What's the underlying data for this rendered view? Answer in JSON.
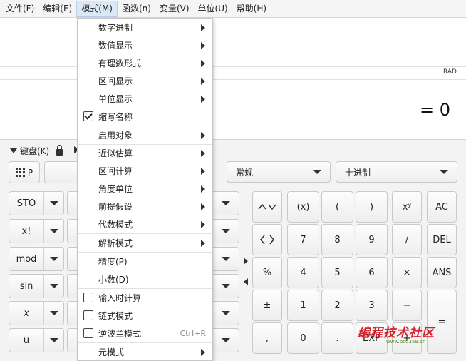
{
  "menubar": {
    "items": [
      "文件(F)",
      "编辑(E)",
      "模式(M)",
      "函数(n)",
      "变量(V)",
      "单位(U)",
      "帮助(H)"
    ],
    "active_index": 2
  },
  "display": {
    "angle_mode": "RAD",
    "result": "= 0"
  },
  "keyboard": {
    "label": "键盘(K)"
  },
  "toolbar": {
    "keypad_button": "P",
    "format_combo": "常规",
    "base_combo": "十进制"
  },
  "left_keys": [
    "STO",
    "x!",
    "mod",
    "sin",
    "x",
    "u"
  ],
  "num_keys": [
    [
      "(x)",
      "(",
      ")",
      "xʸ",
      "AC"
    ],
    [
      "7",
      "8",
      "9",
      "∕",
      "DEL"
    ],
    [
      "4",
      "5",
      "6",
      "×",
      "ANS"
    ],
    [
      "1",
      "2",
      "3",
      "−",
      ""
    ],
    [
      "0",
      ".",
      "EXP",
      "+",
      "="
    ]
  ],
  "special_keys": {
    "percent": "%",
    "plusminus": "±",
    "comma": ","
  },
  "mode_menu": {
    "items": [
      {
        "label": "数字进制",
        "submenu": true
      },
      {
        "label": "数值显示",
        "submenu": true
      },
      {
        "label": "有理数形式",
        "submenu": true
      },
      {
        "label": "区间显示",
        "submenu": true
      },
      {
        "label": "单位显示",
        "submenu": true
      },
      {
        "label": "缩写名称",
        "checkbox": true,
        "checked": true
      },
      {
        "label": "启用对象",
        "submenu": true
      },
      {
        "label": "近似估算",
        "submenu": true
      },
      {
        "label": "区间计算",
        "submenu": true
      },
      {
        "label": "角度单位",
        "submenu": true
      },
      {
        "label": "前提假设",
        "submenu": true
      },
      {
        "label": "代数模式",
        "submenu": true
      },
      {
        "label": "解析模式",
        "submenu": true
      },
      {
        "label": "精度(P)"
      },
      {
        "label": "小数(D)"
      },
      {
        "label": "输入时计算",
        "checkbox": true,
        "checked": false
      },
      {
        "label": "链式模式",
        "checkbox": true,
        "checked": false
      },
      {
        "label": "逆波兰模式",
        "checkbox": true,
        "checked": false,
        "shortcut": "Ctrl+R"
      },
      {
        "label": "元模式",
        "submenu": true
      }
    ]
  },
  "watermark": {
    "text": "编程技术社区",
    "url": "www.pc0359.cn"
  },
  "colors": {
    "menu_active": "#dbe8f7",
    "watermark": "#d4202a"
  }
}
